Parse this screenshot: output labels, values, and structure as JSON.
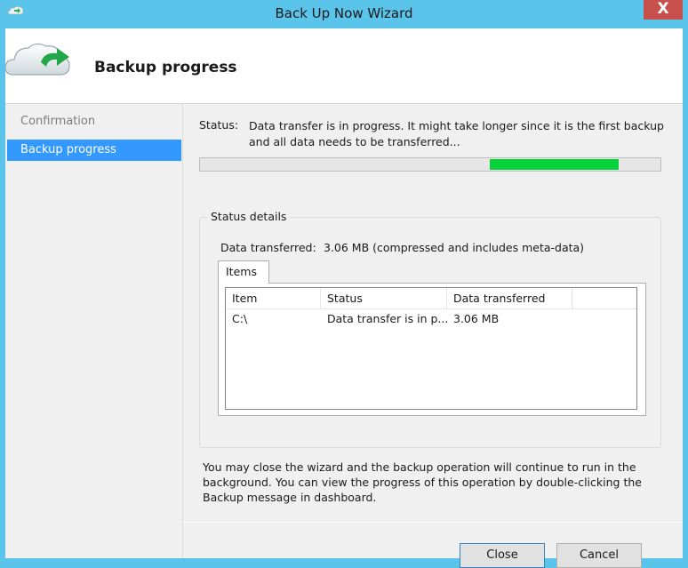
{
  "window": {
    "title": "Back Up Now Wizard",
    "close_glyph": "X"
  },
  "header": {
    "title": "Backup progress",
    "icon": "cloud-backup-icon"
  },
  "sidebar": {
    "items": [
      {
        "label": "Confirmation",
        "active": false
      },
      {
        "label": "Backup progress",
        "active": true
      }
    ]
  },
  "status": {
    "label": "Status:",
    "text": "Data transfer is in progress. It might take longer since it is the first backup and all data needs to be transferred...",
    "progress_color": "#06d33a"
  },
  "details": {
    "legend": "Status details",
    "transferred_label": "Data transferred:",
    "transferred_value": "3.06 MB (compressed and includes meta-data)",
    "tab": "Items",
    "columns": [
      "Item",
      "Status",
      "Data transferred"
    ],
    "rows": [
      {
        "item": "C:\\",
        "status": "Data transfer is in p...",
        "transferred": "3.06 MB"
      }
    ]
  },
  "info": "You may close the wizard and the backup operation will continue to run in the background. You can view the progress of this operation by double-clicking the Backup message in dashboard.",
  "buttons": {
    "close": "Close",
    "cancel": "Cancel"
  },
  "colors": {
    "accent": "#3399ff",
    "frame": "#5bc4ea",
    "close_button": "#c7504d"
  }
}
